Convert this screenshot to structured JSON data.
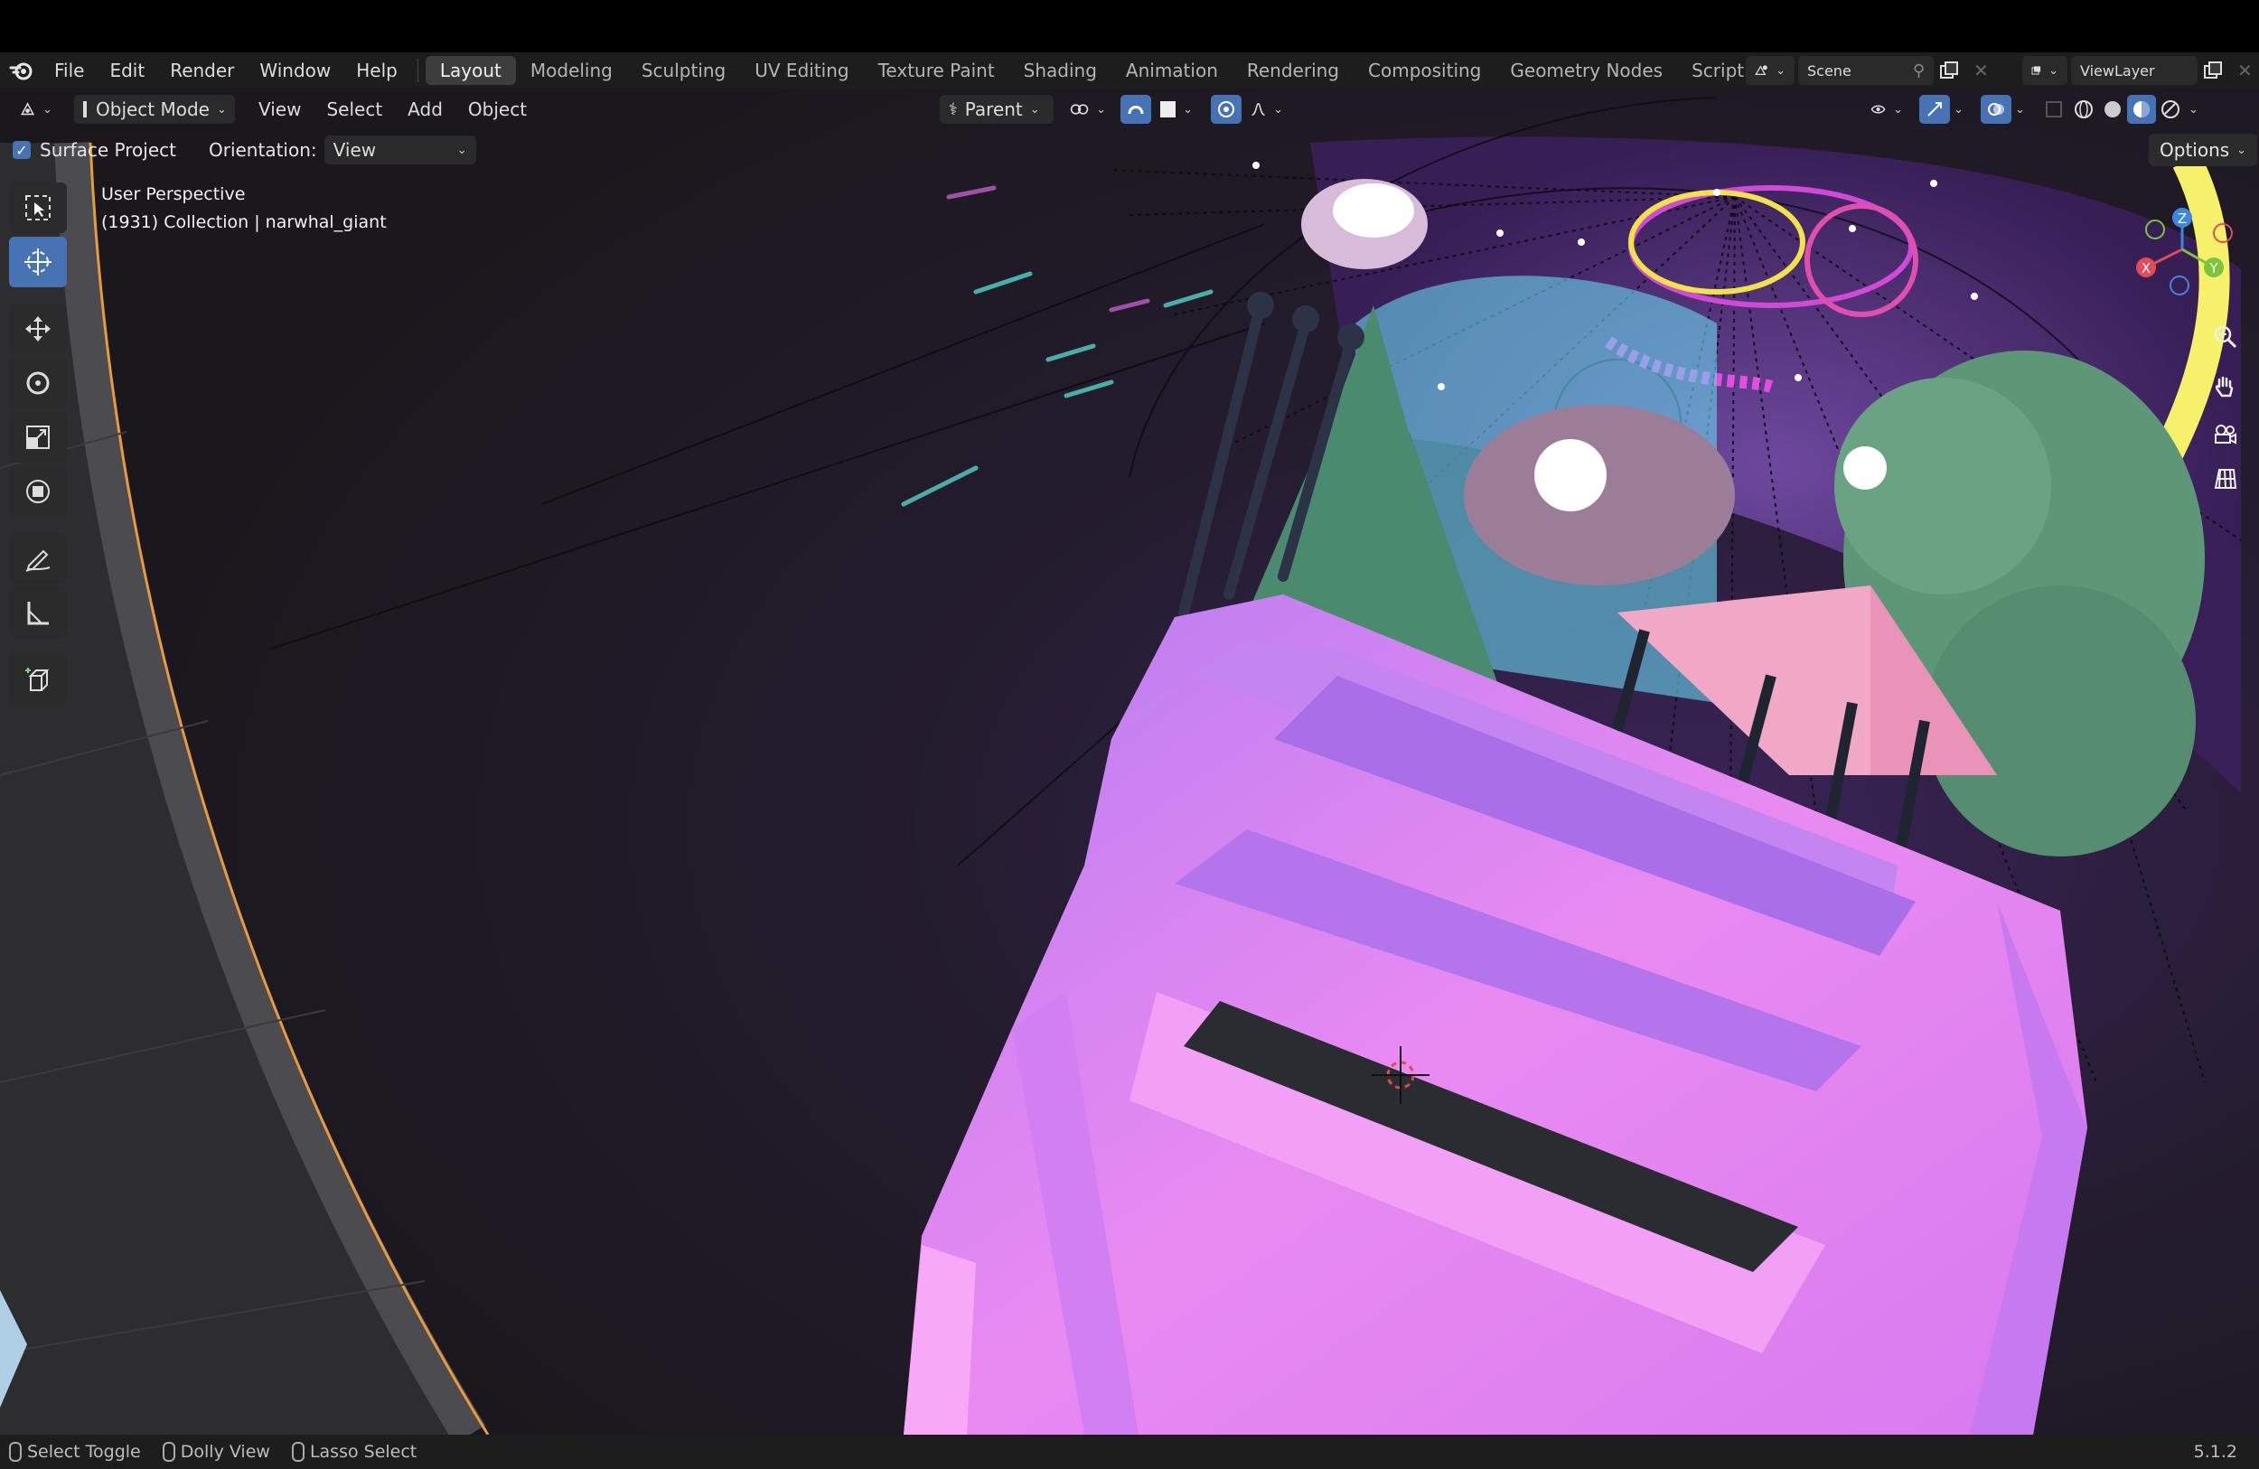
{
  "menu": {
    "items": [
      "File",
      "Edit",
      "Render",
      "Window",
      "Help"
    ]
  },
  "workspaces": {
    "tabs": [
      "Layout",
      "Modeling",
      "Sculpting",
      "UV Editing",
      "Texture Paint",
      "Shading",
      "Animation",
      "Rendering",
      "Compositing",
      "Geometry Nodes",
      "Scripting"
    ],
    "active": "Layout"
  },
  "scene": {
    "name": "Scene"
  },
  "viewlayer": {
    "name": "ViewLayer"
  },
  "header": {
    "mode": "Object Mode",
    "menus": [
      "View",
      "Select",
      "Add",
      "Object"
    ],
    "pivot": "Parent"
  },
  "tool_options": {
    "surface_project": "Surface Project",
    "orientation_label": "Orientation:",
    "orientation_value": "View",
    "options": "Options"
  },
  "overlay": {
    "perspective": "User Perspective",
    "collection": "(1931) Collection | narwhal_giant"
  },
  "gizmo": {
    "x": "X",
    "y": "Y",
    "z": "Z"
  },
  "status": {
    "left": "Select Toggle",
    "middle": "Dolly View",
    "right": "Lasso Select",
    "version": "5.1.2"
  },
  "colors": {
    "active_blue": "#4772b3",
    "pink_object": "#e98af2",
    "axis_x": "#e34a5a",
    "axis_y": "#7cc43a",
    "axis_z": "#3f86df"
  }
}
